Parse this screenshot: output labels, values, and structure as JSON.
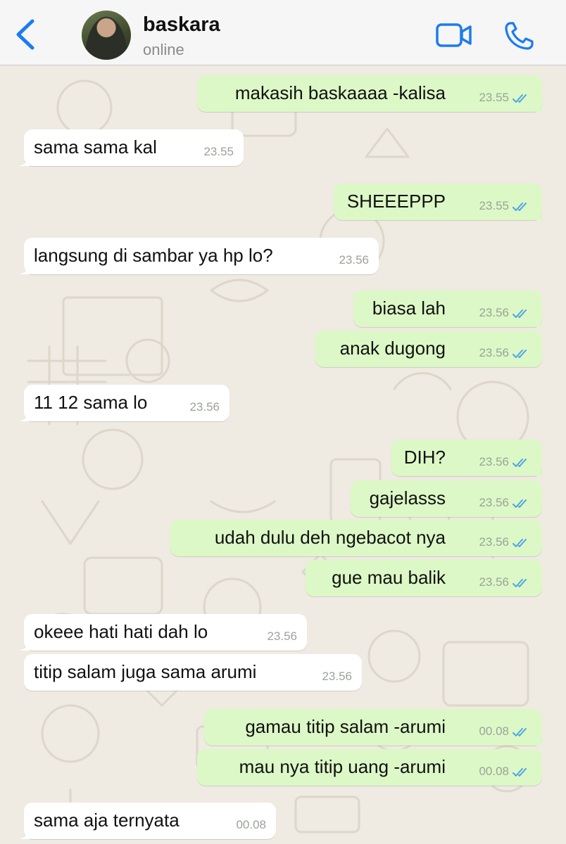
{
  "header": {
    "contact_name": "baskara",
    "status": "online",
    "icons": [
      "back-chevron-icon",
      "video-call-icon",
      "phone-call-icon"
    ],
    "accent_color": "#1a7cf2"
  },
  "colors": {
    "outgoing_bubble": "#dcf8c6",
    "incoming_bubble": "#ffffff",
    "read_ticks": "#4fa4e4"
  },
  "messages": [
    {
      "dir": "out",
      "text": "makasih baskaaaa -kalisa",
      "time": "23.55",
      "read": true
    },
    {
      "dir": "in",
      "text": "sama sama kal",
      "time": "23.55"
    },
    {
      "dir": "out",
      "text": "SHEEEPPP",
      "time": "23.55",
      "read": true
    },
    {
      "dir": "in",
      "text": "langsung di sambar ya hp lo?",
      "time": "23.56"
    },
    {
      "dir": "out",
      "text": "biasa lah",
      "time": "23.56",
      "read": true
    },
    {
      "dir": "out",
      "text": "anak dugong",
      "time": "23.56",
      "read": true
    },
    {
      "dir": "in",
      "text": "11 12 sama lo",
      "time": "23.56"
    },
    {
      "dir": "out",
      "text": "DIH?",
      "time": "23.56",
      "read": true
    },
    {
      "dir": "out",
      "text": "gajelasss",
      "time": "23.56",
      "read": true
    },
    {
      "dir": "out",
      "text": "udah dulu deh ngebacot nya",
      "time": "23.56",
      "read": true
    },
    {
      "dir": "out",
      "text": "gue mau balik",
      "time": "23.56",
      "read": true
    },
    {
      "dir": "in",
      "text": "okeee hati hati dah lo",
      "time": "23.56"
    },
    {
      "dir": "in",
      "text": "titip salam juga sama arumi",
      "time": "23.56"
    },
    {
      "dir": "out",
      "text": "gamau titip salam -arumi",
      "time": "00.08",
      "read": true
    },
    {
      "dir": "out",
      "text": "mau nya titip uang -arumi",
      "time": "00.08",
      "read": true
    },
    {
      "dir": "in",
      "text": "sama aja ternyata",
      "time": "00.08"
    }
  ]
}
